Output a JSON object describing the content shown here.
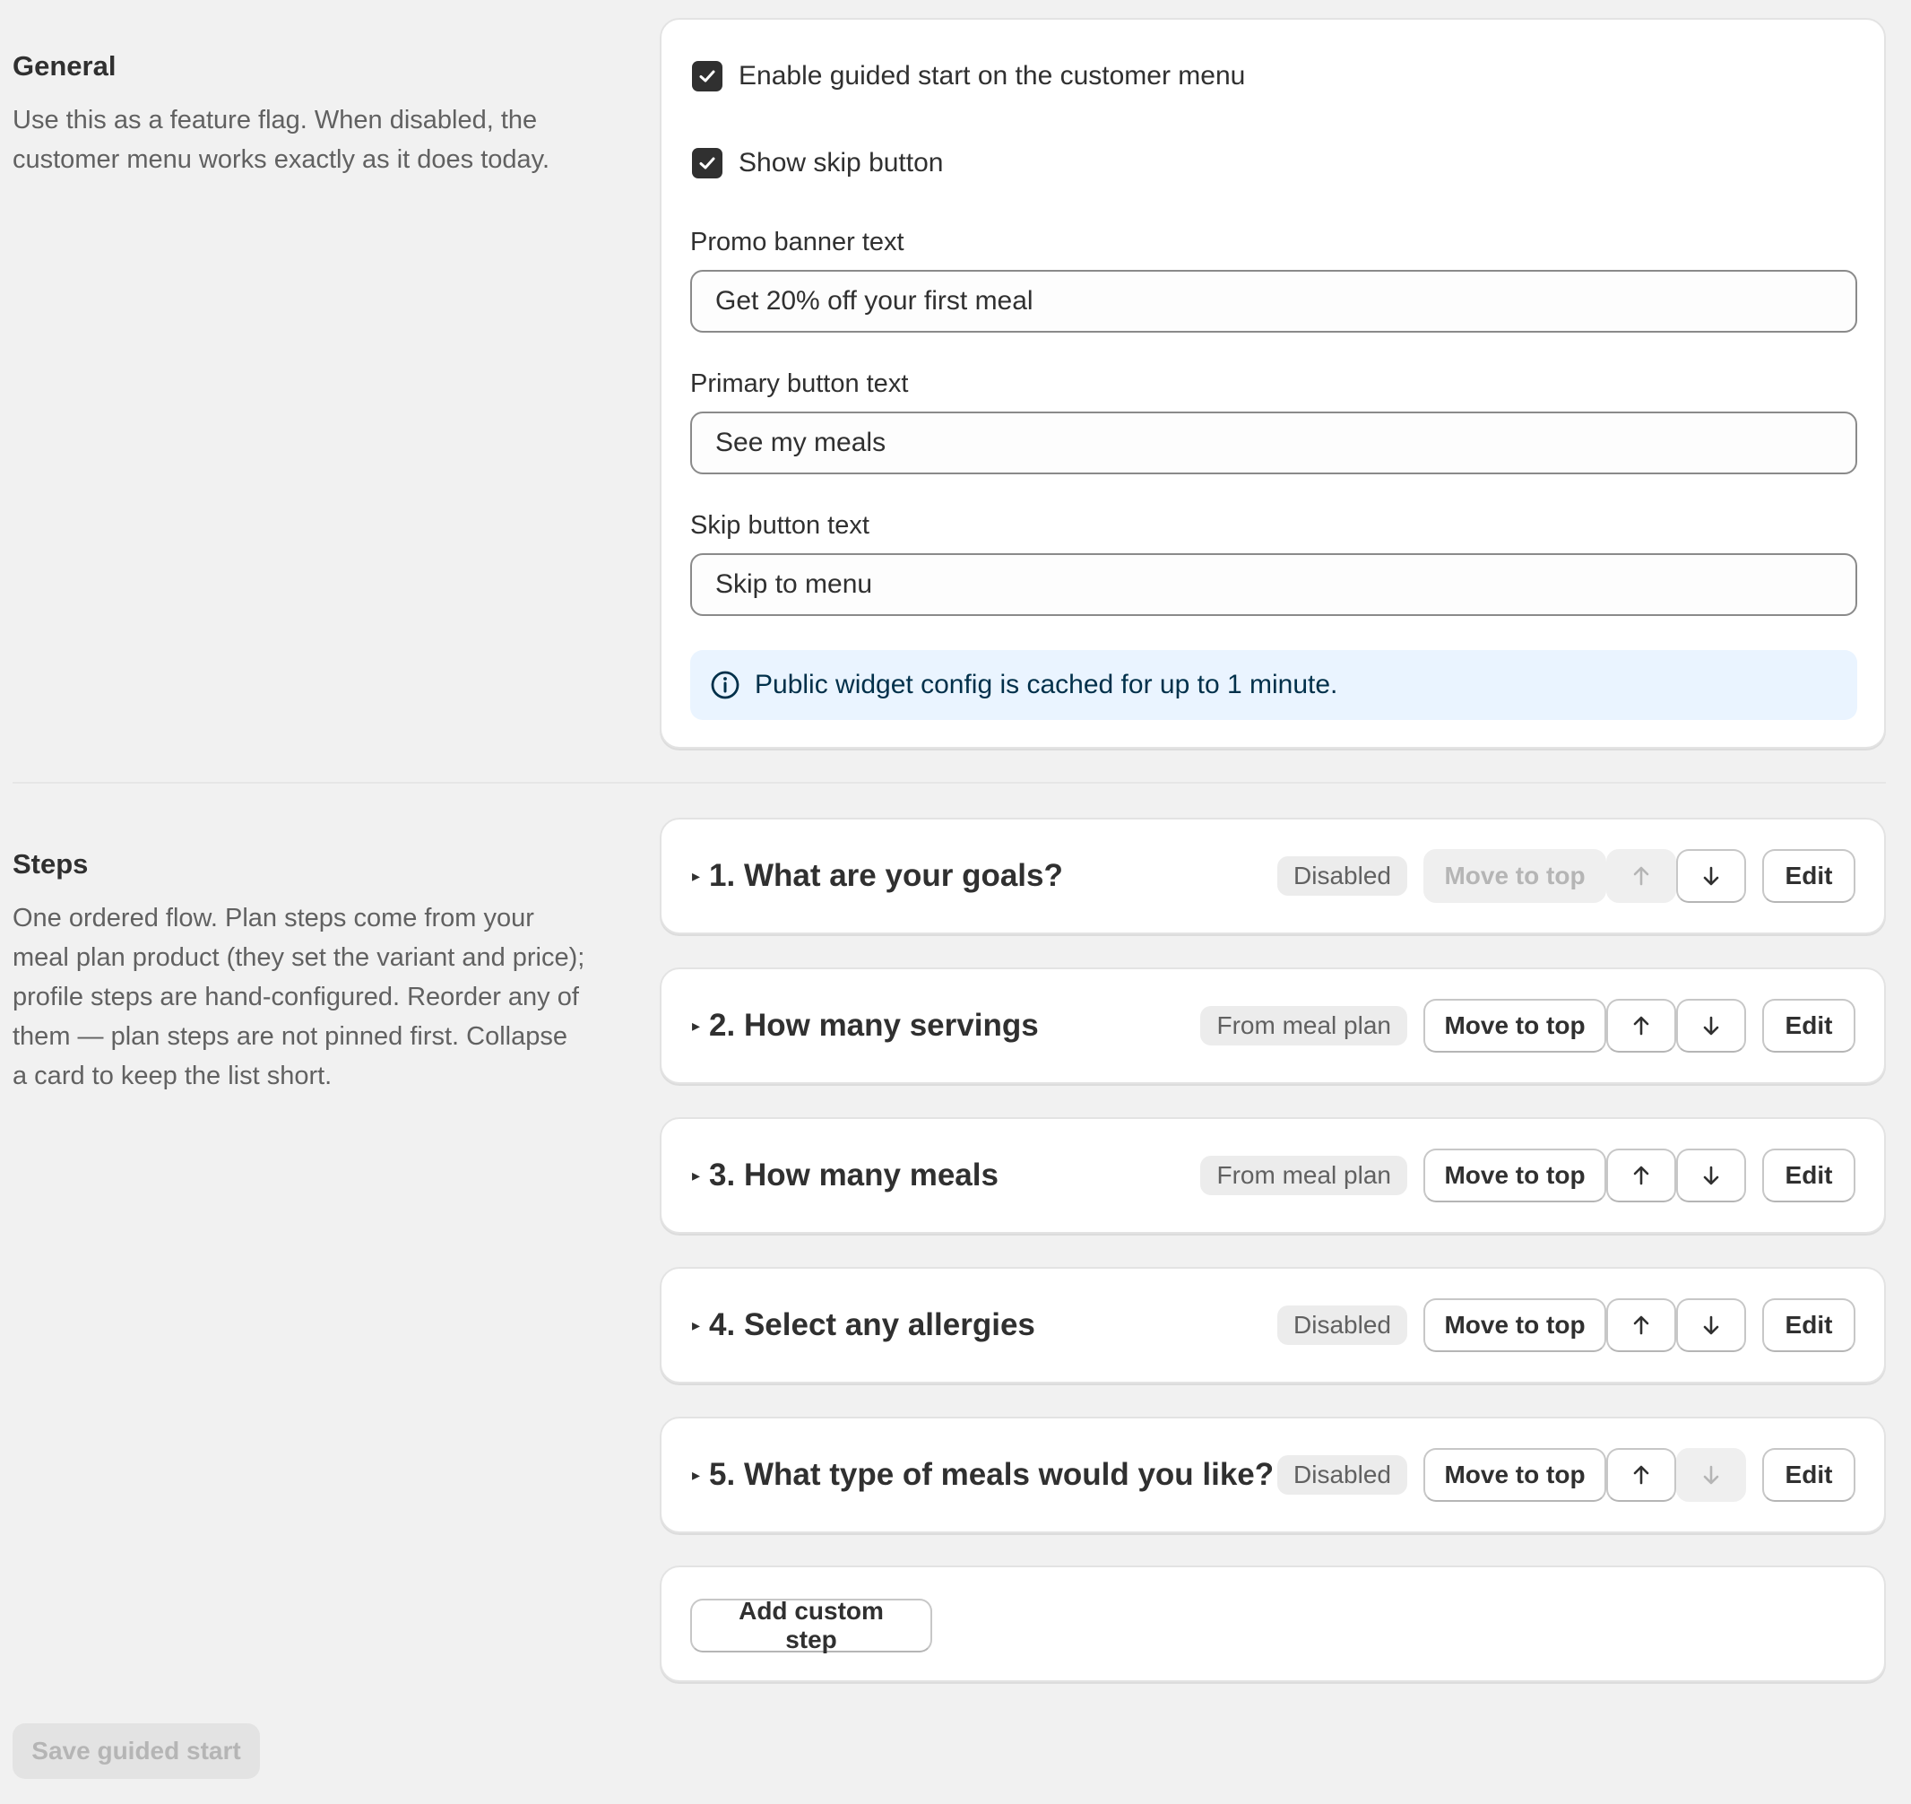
{
  "general": {
    "title": "General",
    "description": "Use this as a feature flag. When disabled, the customer menu works exactly as it does today.",
    "enable_guided_start_label": "Enable guided start on the customer menu",
    "enable_guided_start_checked": true,
    "show_skip_label": "Show skip button",
    "show_skip_checked": true,
    "promo_banner_label": "Promo banner text",
    "promo_banner_value": "Get 20% off your first meal",
    "primary_button_label": "Primary button text",
    "primary_button_value": "See my meals",
    "skip_button_label": "Skip button text",
    "skip_button_value": "Skip to menu",
    "info_banner": "Public widget config is cached for up to 1 minute."
  },
  "steps_section": {
    "title": "Steps",
    "description": "One ordered flow. Plan steps come from your meal plan product (they set the variant and price); profile steps are hand-configured. Reorder any of them — plan steps are not pinned first. Collapse a card to keep the list short.",
    "move_to_top_label": "Move to top",
    "edit_label": "Edit",
    "items": [
      {
        "title": "1. What are your goals?",
        "badge": "Disabled",
        "move_top_disabled": true,
        "up_disabled": true,
        "down_disabled": false
      },
      {
        "title": "2. How many servings",
        "badge": "From meal plan",
        "move_top_disabled": false,
        "up_disabled": false,
        "down_disabled": false
      },
      {
        "title": "3. How many meals",
        "badge": "From meal plan",
        "move_top_disabled": false,
        "up_disabled": false,
        "down_disabled": false
      },
      {
        "title": "4. Select any allergies",
        "badge": "Disabled",
        "move_top_disabled": false,
        "up_disabled": false,
        "down_disabled": false
      },
      {
        "title": "5. What type of meals would you like?",
        "badge": "Disabled",
        "move_top_disabled": false,
        "up_disabled": false,
        "down_disabled": true
      }
    ],
    "add_custom_step_label": "Add custom step"
  },
  "footer": {
    "save_label": "Save guided start"
  },
  "icons": {
    "check": "checkmark-icon",
    "info": "info-icon",
    "caret": "caret-right-icon",
    "up": "arrow-up-icon",
    "down": "arrow-down-icon"
  }
}
